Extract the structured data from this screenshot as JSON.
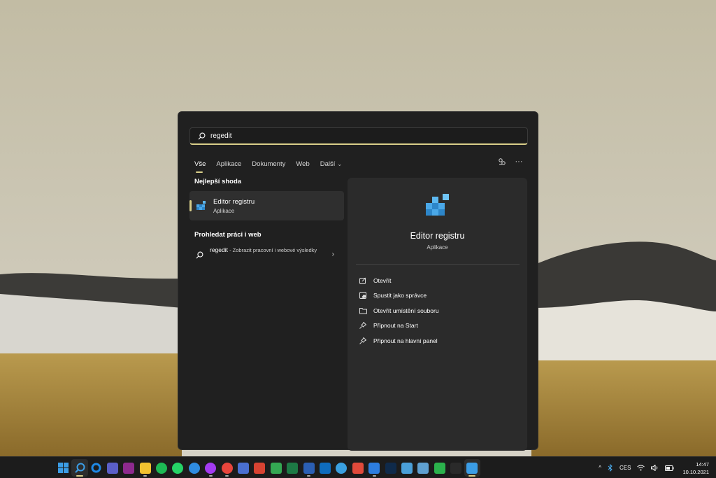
{
  "search": {
    "query": "regedit"
  },
  "tabs": [
    {
      "label": "Vše"
    },
    {
      "label": "Aplikace"
    },
    {
      "label": "Dokumenty"
    },
    {
      "label": "Web"
    },
    {
      "label": "Další"
    }
  ],
  "tab_actions": {
    "share_icon": "share-icon",
    "more_label": "···"
  },
  "best_match": {
    "section_title": "Nejlepší shoda",
    "name": "Editor registru",
    "type": "Aplikace"
  },
  "web_search": {
    "section_title": "Prohledat práci i web",
    "query": "regedit",
    "description": " - Zobrazit pracovní i webové výsledky"
  },
  "detail": {
    "name": "Editor registru",
    "type": "Aplikace",
    "actions": [
      {
        "label": "Otevřít",
        "icon": "open-icon"
      },
      {
        "label": "Spustit jako správce",
        "icon": "shield-icon"
      },
      {
        "label": "Otevřít umístění souboru",
        "icon": "folder-icon"
      },
      {
        "label": "Připnout na Start",
        "icon": "pin-icon"
      },
      {
        "label": "Připnout na hlavní panel",
        "icon": "pin-icon"
      }
    ]
  },
  "taskbar": {
    "apps": [
      {
        "name": "start",
        "color": "#3b9de6"
      },
      {
        "name": "search",
        "color": "#3b9de6",
        "active": true
      },
      {
        "name": "cortana",
        "color": "#1e88e5"
      },
      {
        "name": "teams",
        "color": "#5b5fc7"
      },
      {
        "name": "app-g",
        "color": "#8e2a8e"
      },
      {
        "name": "file-explorer",
        "color": "#f2c230"
      },
      {
        "name": "spotify",
        "color": "#1db954"
      },
      {
        "name": "whatsapp",
        "color": "#25d366"
      },
      {
        "name": "headphones-app",
        "color": "#2f8ce0"
      },
      {
        "name": "messenger",
        "color": "#a33bf0"
      },
      {
        "name": "chrome",
        "color": "#e8453c"
      },
      {
        "name": "save-app",
        "color": "#4a6fd1"
      },
      {
        "name": "ccleaner",
        "color": "#d84332"
      },
      {
        "name": "google-drive",
        "color": "#34a853"
      },
      {
        "name": "excel",
        "color": "#1d7a45"
      },
      {
        "name": "word",
        "color": "#2b5fb4"
      },
      {
        "name": "outlook",
        "color": "#0f6cbd"
      },
      {
        "name": "sync-app",
        "color": "#3aa0e0"
      },
      {
        "name": "gmail",
        "color": "#e04a3b"
      },
      {
        "name": "todo",
        "color": "#2d7de0"
      },
      {
        "name": "photoshop",
        "color": "#0f2a4a"
      },
      {
        "name": "remote-desktop",
        "color": "#4a9fd8"
      },
      {
        "name": "photos",
        "color": "#5fa0d0"
      },
      {
        "name": "feedly",
        "color": "#2bb24c"
      },
      {
        "name": "terminal",
        "color": "#2a2a2a"
      },
      {
        "name": "regedit",
        "color": "#3b9de6",
        "active": true
      }
    ],
    "tray": {
      "chevron": "^",
      "bluetooth": "bluetooth-icon",
      "language": "CES",
      "wifi": "wifi-icon",
      "volume": "volume-icon",
      "battery": "battery-icon"
    },
    "time": "14:47",
    "date": "10.10.2021"
  }
}
